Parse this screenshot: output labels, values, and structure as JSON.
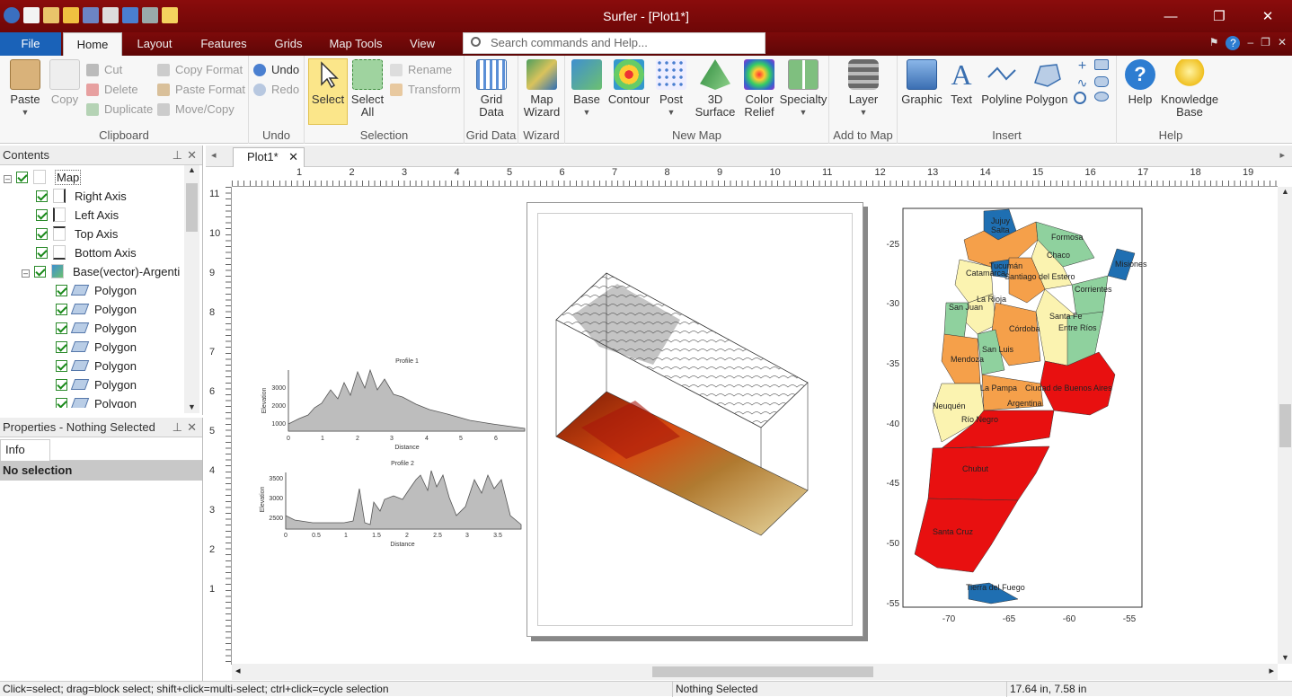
{
  "app": {
    "title": "Surfer - [Plot1*]"
  },
  "window": {
    "minimize": "—",
    "restore": "❐",
    "close": "✕"
  },
  "ribbon_tabs": [
    "File",
    "Home",
    "Layout",
    "Features",
    "Grids",
    "Map Tools",
    "View"
  ],
  "search_placeholder": "Search commands and Help...",
  "clipboard": {
    "paste": "Paste",
    "copy": "Copy",
    "cut": "Cut",
    "delete": "Delete",
    "duplicate": "Duplicate",
    "copy_format": "Copy Format",
    "paste_format": "Paste Format",
    "move_copy": "Move/Copy",
    "label": "Clipboard"
  },
  "undo_group": {
    "undo": "Undo",
    "redo": "Redo",
    "label": "Undo"
  },
  "selection_group": {
    "select": "Select",
    "select_all_1": "Select",
    "select_all_2": "All",
    "rename": "Rename",
    "transform": "Transform",
    "label": "Selection"
  },
  "griddata_group": {
    "btn1": "Grid",
    "btn2": "Data",
    "label": "Grid Data"
  },
  "wizard_group": {
    "btn1": "Map",
    "btn2": "Wizard",
    "label": "Wizard"
  },
  "newmap_group": {
    "base": "Base",
    "contour": "Contour",
    "post": "Post",
    "surface1": "3D",
    "surface2": "Surface",
    "relief1": "Color",
    "relief2": "Relief",
    "specialty": "Specialty",
    "label": "New Map"
  },
  "addmap_group": {
    "layer": "Layer",
    "label": "Add to Map"
  },
  "insert_group": {
    "graphic": "Graphic",
    "text": "Text",
    "polyline": "Polyline",
    "polygon": "Polygon",
    "label": "Insert"
  },
  "help_group": {
    "help": "Help",
    "kb1": "Knowledge",
    "kb2": "Base",
    "label": "Help"
  },
  "contents": {
    "title": "Contents",
    "items": [
      {
        "label": "Map"
      },
      {
        "label": "Right Axis"
      },
      {
        "label": "Left Axis"
      },
      {
        "label": "Top Axis"
      },
      {
        "label": "Bottom Axis"
      },
      {
        "label": "Base(vector)-Argenti"
      },
      {
        "label": "Polygon"
      },
      {
        "label": "Polygon"
      },
      {
        "label": "Polygon"
      },
      {
        "label": "Polygon"
      },
      {
        "label": "Polygon"
      },
      {
        "label": "Polygon"
      },
      {
        "label": "Polygon"
      }
    ]
  },
  "properties": {
    "title": "Properties - Nothing Selected",
    "tab": "Info",
    "selection": "No selection"
  },
  "doc_tab": "Plot1*",
  "hruler_numbers": [
    "1",
    "2",
    "3",
    "4",
    "5",
    "6",
    "7",
    "8",
    "9",
    "10",
    "11",
    "12",
    "13",
    "14",
    "15",
    "16",
    "17",
    "18",
    "19"
  ],
  "vruler_numbers": [
    "11",
    "10",
    "9",
    "8",
    "7",
    "6",
    "5",
    "4",
    "3",
    "2",
    "1"
  ],
  "profile1": {
    "title": "Profile 1",
    "xlabel": "Distance",
    "ylabel": "Elevation",
    "yticks": [
      "1000",
      "2000",
      "3000"
    ],
    "xticks": [
      "0",
      "1",
      "2",
      "3",
      "4",
      "5",
      "6"
    ]
  },
  "profile2": {
    "title": "Profile 2",
    "xlabel": "Distance",
    "ylabel": "Elevation",
    "yticks": [
      "2500",
      "3000",
      "3500"
    ],
    "xticks": [
      "0",
      "0.5",
      "1",
      "1.5",
      "2",
      "2.5",
      "3",
      "3.5"
    ]
  },
  "map": {
    "yticks": [
      "-25",
      "-30",
      "-35",
      "-40",
      "-45",
      "-50",
      "-55"
    ],
    "xticks": [
      "-70",
      "-65",
      "-60",
      "-55"
    ],
    "provinces": [
      "Jujuy",
      "Salta",
      "Formosa",
      "Chaco",
      "Misiones",
      "Tucumán",
      "Santiago del Estero",
      "Catamarca",
      "Corrientes",
      "La Rioja",
      "San Juan",
      "Santa Fe",
      "Córdoba",
      "Entre Ríos",
      "San Luis",
      "Mendoza",
      "Ciudad de Buenos Aires",
      "La Pampa",
      "Argentina",
      "Neuquén",
      "Río Negro",
      "Chubut",
      "Santa Cruz",
      "Tierra del Fuego"
    ],
    "colors": {
      "blue": "#1f6fb2",
      "orange": "#f5a04a",
      "yellow": "#fbf3b0",
      "green": "#8fd19e",
      "red": "#e81010"
    }
  },
  "status": {
    "hint": "Click=select; drag=block select; shift+click=multi-select; ctrl+click=cycle selection",
    "selected": "Nothing Selected",
    "coords": "17.64 in, 7.58 in"
  }
}
